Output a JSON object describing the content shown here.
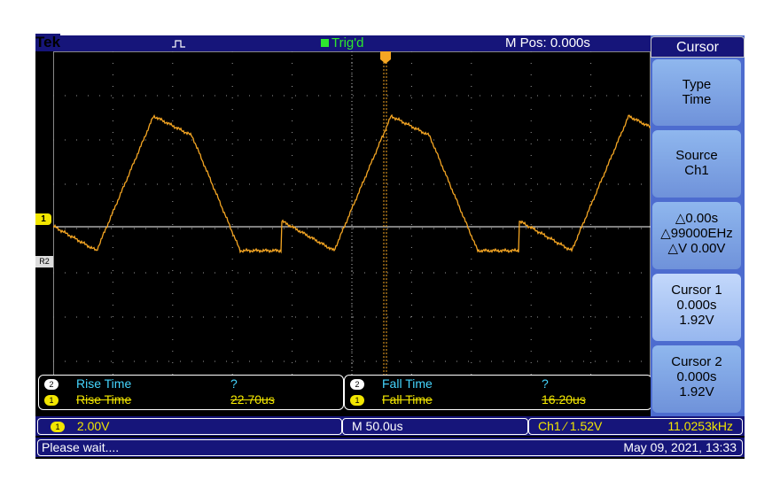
{
  "header": {
    "brand": "Tek",
    "trigger_status": "Trig'd",
    "m_pos": "M Pos: 0.000s"
  },
  "markers": {
    "ch1": "1",
    "ref": "R2"
  },
  "waveform": {
    "color": "#f5a623",
    "description_points": "periodic triangle-like wave"
  },
  "measurements": {
    "left": [
      {
        "chip": "2",
        "label": "Rise Time",
        "value": "?"
      },
      {
        "chip": "1",
        "label": "Rise Time",
        "value": "22.70us"
      }
    ],
    "right": [
      {
        "chip": "2",
        "label": "Fall Time",
        "value": "?"
      },
      {
        "chip": "1",
        "label": "Fall Time",
        "value": "16.20us"
      }
    ]
  },
  "status": {
    "ch_num": "1",
    "volts_div": "2.00V",
    "timebase": "M 50.0us",
    "trigger": "Ch1 ∕ 1.52V",
    "frequency": "11.0253kHz",
    "message": "Please wait....",
    "datetime": "May 09, 2021, 13:33"
  },
  "menu": {
    "title": "Cursor",
    "buttons": [
      {
        "lines": [
          "Type",
          "Time"
        ]
      },
      {
        "lines": [
          "Source",
          "Ch1"
        ]
      },
      {
        "lines": [
          "△0.00s",
          "△99000EHz",
          "△V 0.00V"
        ]
      },
      {
        "lines": [
          "Cursor 1",
          "0.000s",
          "1.92V"
        ]
      },
      {
        "lines": [
          "Cursor 2",
          "0.000s",
          "1.92V"
        ]
      }
    ]
  }
}
